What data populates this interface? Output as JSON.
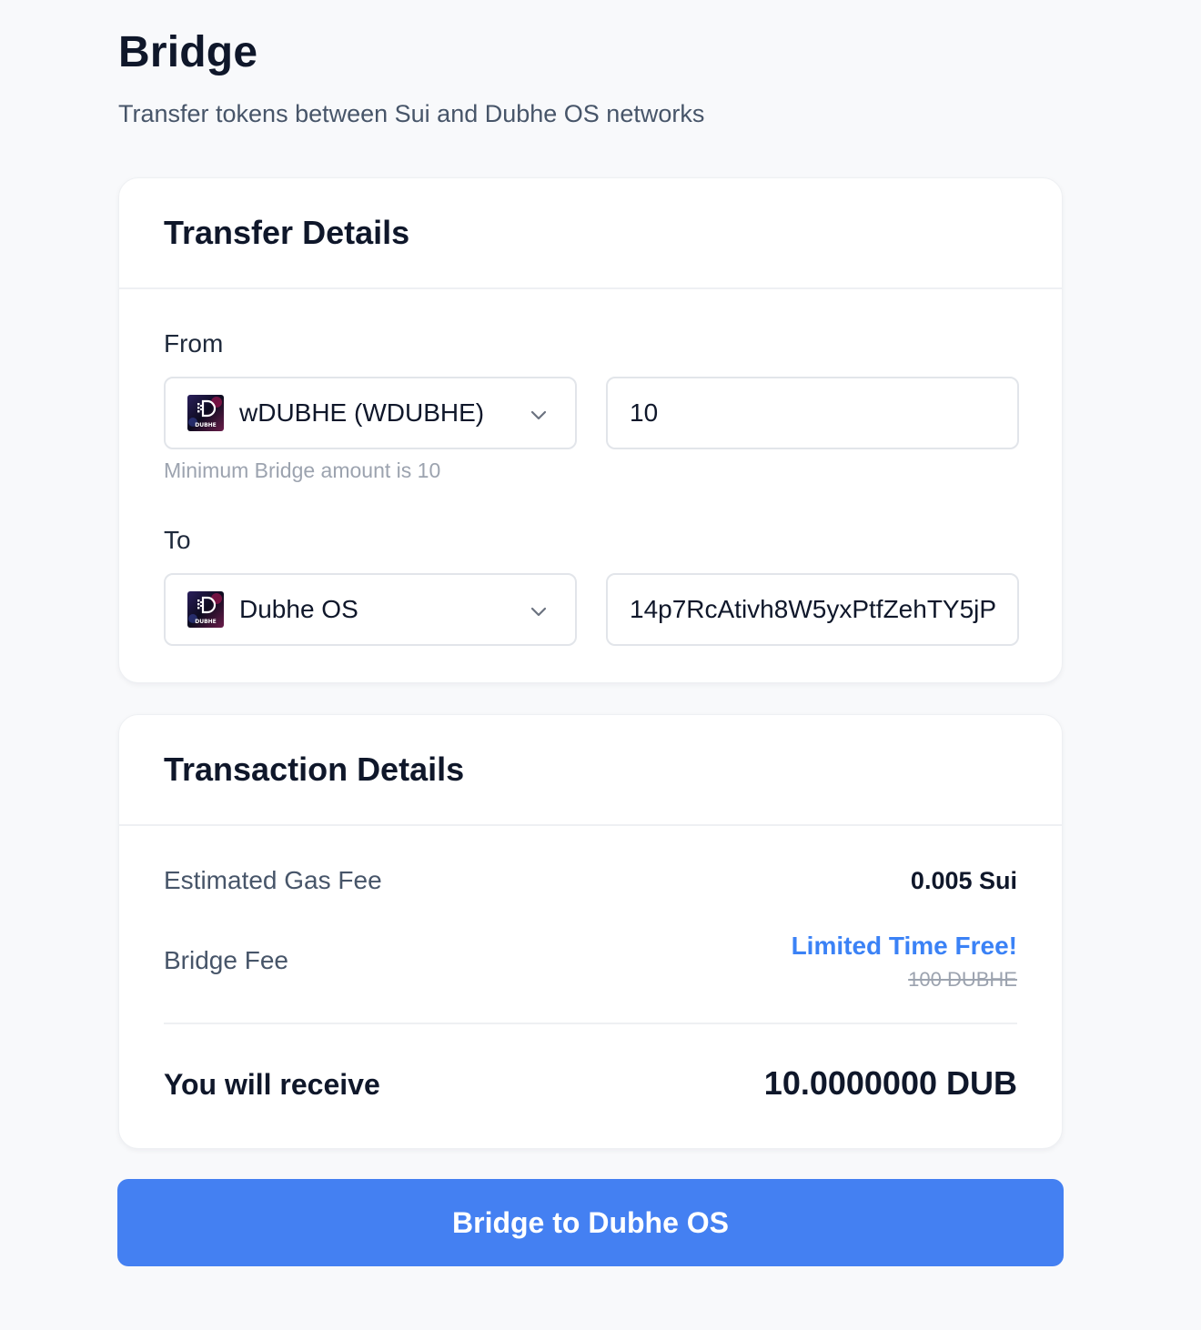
{
  "page": {
    "title": "Bridge",
    "subtitle": "Transfer tokens between Sui and Dubhe OS networks"
  },
  "transfer": {
    "title": "Transfer Details",
    "from": {
      "label": "From",
      "token": "wDUBHE (WDUBHE)",
      "amount": "10",
      "hint": "Minimum Bridge amount is 10"
    },
    "to": {
      "label": "To",
      "network": "Dubhe OS",
      "address": "14p7RcAtivh8W5yxPtfZehTY5jP"
    },
    "logo_text": "DUBHE"
  },
  "transaction": {
    "title": "Transaction Details",
    "gas_fee_label": "Estimated Gas Fee",
    "gas_fee_value": "0.005 Sui",
    "bridge_fee_label": "Bridge Fee",
    "bridge_fee_promo": "Limited Time Free!",
    "bridge_fee_original": "100 DUBHE",
    "receive_label": "You will receive",
    "receive_value": "10.0000000 DUB"
  },
  "action": {
    "button_label": "Bridge to Dubhe OS"
  },
  "colors": {
    "accent": "#4480f2",
    "promo": "#3b82f6",
    "background": "#f8f9fb"
  },
  "icons": {
    "token_logo": "dubhe-logo-icon",
    "dropdown": "chevron-down-icon"
  }
}
